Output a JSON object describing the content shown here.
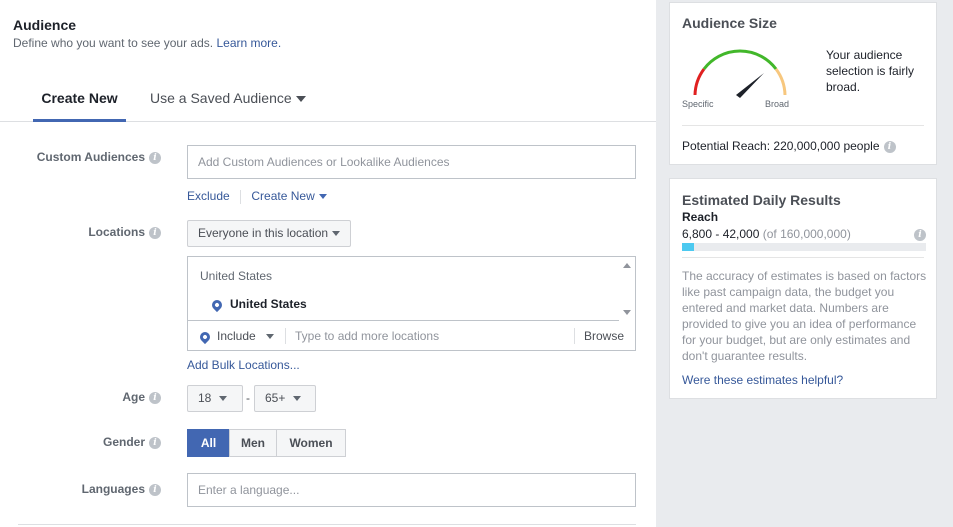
{
  "audience": {
    "title": "Audience",
    "subtitle": "Define who you want to see your ads.",
    "learn_more": "Learn more."
  },
  "tabs": [
    {
      "label": "Create New",
      "active": true
    },
    {
      "label": "Use a Saved Audience",
      "active": false
    }
  ],
  "custom_audiences": {
    "label": "Custom Audiences",
    "placeholder": "Add Custom Audiences or Lookalike Audiences",
    "exclude": "Exclude",
    "create_new": "Create New"
  },
  "locations": {
    "label": "Locations",
    "dropdown": "Everyone in this location",
    "group_header": "United States",
    "selected": "United States",
    "include": "Include",
    "placeholder": "Type to add more locations",
    "browse": "Browse",
    "bulk": "Add Bulk Locations..."
  },
  "age": {
    "label": "Age",
    "min": "18",
    "separator": "-",
    "max": "65+"
  },
  "gender": {
    "label": "Gender",
    "options": [
      "All",
      "Men",
      "Women"
    ],
    "selected": "All"
  },
  "languages": {
    "label": "Languages",
    "placeholder": "Enter a language..."
  },
  "audience_size": {
    "title": "Audience Size",
    "description": "Your audience selection is fairly broad.",
    "specific": "Specific",
    "broad": "Broad",
    "potential_reach": "Potential Reach: 220,000,000 people",
    "gauge_level": 0.75
  },
  "daily_results": {
    "title": "Estimated Daily Results",
    "reach_label": "Reach",
    "reach_range": "6,800 - 42,000",
    "reach_total": "(of 160,000,000)",
    "reach_fraction": 0.05,
    "disclaimer": "The accuracy of estimates is based on factors like past campaign data, the budget you entered and market data. Numbers are provided to give you an idea of performance for your budget, but are only estimates and don't guarantee results.",
    "feedback_link": "Were these estimates helpful?"
  },
  "colors": {
    "accent": "#4267b2",
    "link": "#365899",
    "gauge_red": "#e02020",
    "gauge_green": "#42b72a",
    "gauge_orange": "#f7b928",
    "reach_bar": "#4cc9f0"
  }
}
